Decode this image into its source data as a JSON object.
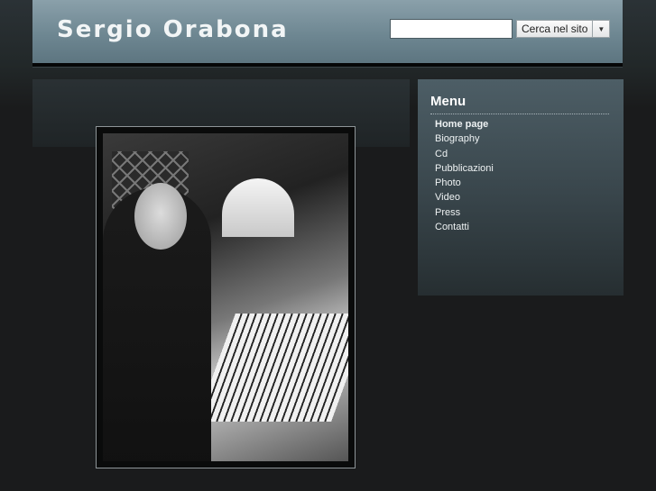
{
  "header": {
    "site_title": "Sergio Orabona",
    "search": {
      "value": "",
      "placeholder": "",
      "button_label": "Cerca nel sito"
    }
  },
  "sidebar": {
    "title": "Menu",
    "items": [
      {
        "label": "Home page",
        "active": true
      },
      {
        "label": "Biography"
      },
      {
        "label": "Cd"
      },
      {
        "label": "Pubblicazioni"
      },
      {
        "label": "Photo"
      },
      {
        "label": "Video"
      },
      {
        "label": "Press"
      },
      {
        "label": "Contatti"
      }
    ]
  },
  "colors": {
    "header": "#6e8792",
    "background": "#1a1b1c",
    "sidebar": "#3a474d"
  },
  "icons": {
    "search_dropdown": "chevron-down-icon"
  }
}
